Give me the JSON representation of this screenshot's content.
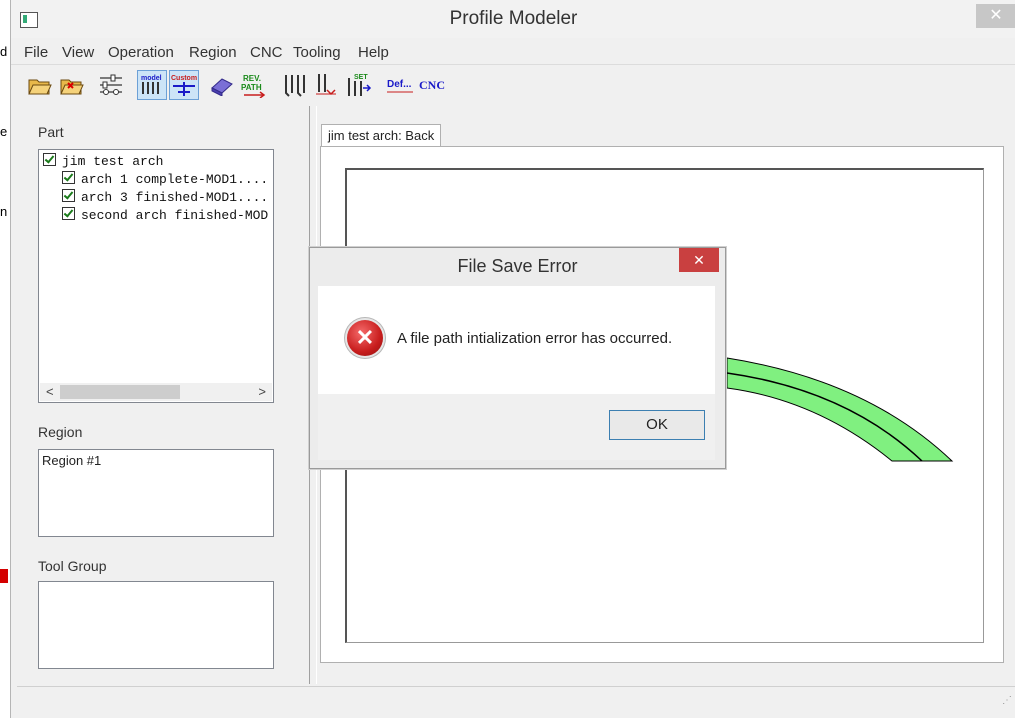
{
  "background_window": {
    "letters": [
      "d",
      "e",
      "n"
    ]
  },
  "window": {
    "title": "Profile Modeler",
    "close_glyph": "✕"
  },
  "menu": [
    "File",
    "View",
    "Operation",
    "Region",
    "CNC",
    "Tooling",
    "Help"
  ],
  "toolbar": {
    "icons": [
      "open-folder-icon",
      "save-folder-icon",
      "settings-sliders-icon",
      "model-icon",
      "custom-icon",
      "eraser-icon",
      "rev-path-icon",
      "tools-icon",
      "tool-change-icon",
      "set-tool-icon",
      "def-icon",
      "cnc-icon"
    ],
    "model_label": "model",
    "custom_label": "Custom",
    "rev_label": "REV.",
    "path_label": "PATH",
    "set_label": "SET",
    "def_label": "Def...",
    "cnc_label": "CNC"
  },
  "part_panel": {
    "label": "Part",
    "tree": [
      {
        "text": "jim test arch",
        "checked": true,
        "level": 0
      },
      {
        "text": "arch 1 complete-MOD1....",
        "checked": true,
        "level": 1
      },
      {
        "text": "arch 3 finished-MOD1....",
        "checked": true,
        "level": 1
      },
      {
        "text": "second arch finished-MOD",
        "checked": true,
        "level": 1
      }
    ],
    "scroll_left": "<",
    "scroll_right": ">"
  },
  "region_panel": {
    "label": "Region",
    "items": [
      "Region #1"
    ]
  },
  "tool_group_panel": {
    "label": "Tool Group"
  },
  "tab": {
    "label": "jim test arch: Back"
  },
  "colors": {
    "arch_fill": "#80f080",
    "dialog_close": "#c94040",
    "error_red": "#c81d1d"
  },
  "dialog": {
    "title": "File Save Error",
    "close_glyph": "✕",
    "message": "A file path intialization error has occurred.",
    "ok_label": "OK",
    "icon": "error-icon"
  }
}
